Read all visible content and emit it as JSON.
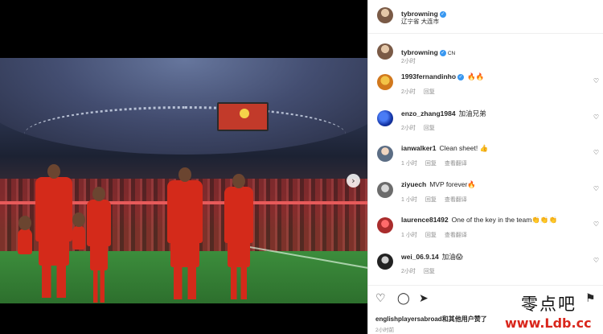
{
  "post": {
    "author": "tybrowning",
    "location": "辽宁省 大连市",
    "caption_author": "tybrowning",
    "caption_flag": "CN",
    "caption_time": "2小时"
  },
  "comments": [
    {
      "user": "1993fernandinho",
      "verified": true,
      "text": "🔥🔥",
      "time": "2小时",
      "reply": "回复",
      "translate": ""
    },
    {
      "user": "enzo_zhang1984",
      "verified": false,
      "text": "加油兄弟",
      "time": "2小时",
      "reply": "回复",
      "translate": ""
    },
    {
      "user": "ianwalker1",
      "verified": false,
      "text": "Clean sheet! 👍",
      "time": "1 小时",
      "reply": "回复",
      "translate": "查看翻译"
    },
    {
      "user": "ziyuech",
      "verified": false,
      "text": "MVP forever🔥",
      "time": "1 小时",
      "reply": "回复",
      "translate": "查看翻译"
    },
    {
      "user": "laurence81492",
      "verified": false,
      "text": "One of the key in the team👏👏👏",
      "time": "1 小时",
      "reply": "回复",
      "translate": "查看翻译"
    },
    {
      "user": "wei_06.9.14",
      "verified": false,
      "text": "加油😱",
      "time": "2小时",
      "reply": "回复",
      "translate": ""
    }
  ],
  "actions": {
    "like_icon": "heart-icon",
    "comment_icon": "comment-icon",
    "share_icon": "share-icon",
    "save_icon": "bookmark-icon"
  },
  "likes_text": "englishplayersabroad和其他用户赞了",
  "footer_time": "2小时前",
  "watermark": {
    "cn": "零点吧",
    "url": "www.Ldb.cc"
  },
  "colors": {
    "verified": "#3897f0",
    "muted": "#8e8e8e",
    "watermark_url": "#d9261c"
  }
}
